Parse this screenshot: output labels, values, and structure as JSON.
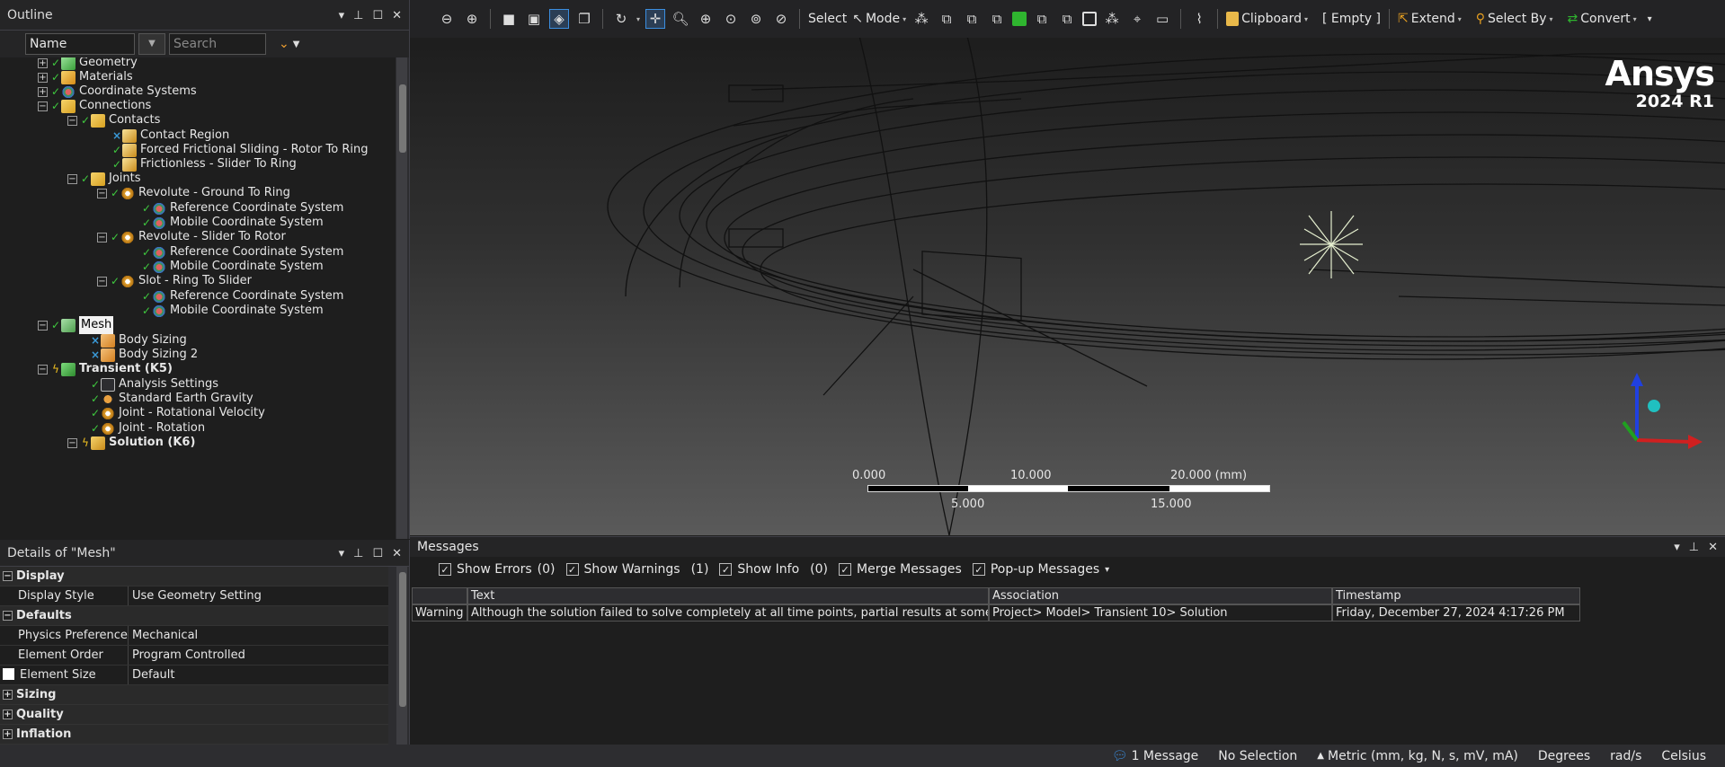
{
  "outline": {
    "title": "Outline",
    "filter_select": "Name",
    "search_placeholder": "Search Outline",
    "tree": [
      {
        "label": "Geometry"
      },
      {
        "label": "Materials"
      },
      {
        "label": "Coordinate Systems"
      },
      {
        "label": "Connections"
      },
      {
        "label": "Contacts"
      },
      {
        "label": "Contact Region"
      },
      {
        "label": "Forced Frictional Sliding - Rotor To Ring"
      },
      {
        "label": "Frictionless - Slider To Ring"
      },
      {
        "label": "Joints"
      },
      {
        "label": "Revolute - Ground To Ring"
      },
      {
        "label": "Reference Coordinate System"
      },
      {
        "label": "Mobile Coordinate System"
      },
      {
        "label": "Revolute - Slider To Rotor"
      },
      {
        "label": "Reference Coordinate System"
      },
      {
        "label": "Mobile Coordinate System"
      },
      {
        "label": "Slot - Ring To Slider"
      },
      {
        "label": "Reference Coordinate System"
      },
      {
        "label": "Mobile Coordinate System"
      },
      {
        "label": "Mesh"
      },
      {
        "label": "Body Sizing"
      },
      {
        "label": "Body Sizing 2"
      },
      {
        "label": "Transient (K5)"
      },
      {
        "label": "Analysis Settings"
      },
      {
        "label": "Standard Earth Gravity"
      },
      {
        "label": "Joint - Rotational Velocity"
      },
      {
        "label": "Joint - Rotation"
      },
      {
        "label": "Solution (K6)"
      }
    ]
  },
  "details": {
    "title": "Details of \"Mesh\"",
    "rows": [
      {
        "key": "Display"
      },
      {
        "key": "Display Style",
        "value": "Use Geometry Setting"
      },
      {
        "key": "Defaults"
      },
      {
        "key": "Physics Preference",
        "value": "Mechanical"
      },
      {
        "key": "Element Order",
        "value": "Program Controlled"
      },
      {
        "key": "Element Size",
        "value": "Default"
      },
      {
        "key": "Sizing"
      },
      {
        "key": "Quality"
      },
      {
        "key": "Inflation"
      }
    ]
  },
  "toolbar": {
    "select": "Select",
    "mode": "Mode",
    "clipboard": "Clipboard",
    "empty": "[ Empty ]",
    "extend": "Extend",
    "select_by": "Select By",
    "convert": "Convert"
  },
  "brand": {
    "name": "Ansys",
    "version": "2024 R1"
  },
  "scale": {
    "top": [
      "0.000",
      "10.000",
      "20.000 (mm)"
    ],
    "bottom": [
      "5.000",
      "15.000"
    ]
  },
  "messages": {
    "title": "Messages",
    "opts": [
      {
        "label": "Show Errors",
        "count": "(0)"
      },
      {
        "label": "Show Warnings",
        "count": "(1)"
      },
      {
        "label": "Show Info",
        "count": "(0)"
      },
      {
        "label": "Merge Messages",
        "count": ""
      },
      {
        "label": "Pop-up Messages",
        "count": ""
      }
    ],
    "headers": [
      "Text",
      "Association",
      "Timestamp"
    ],
    "row": {
      "type": "Warning",
      "text": "Although the solution failed to solve completely at all time points, partial results at some",
      "association": "Project> Model> Transient 10> Solution",
      "timestamp": "Friday, December 27, 2024 4:17:26 PM"
    }
  },
  "statusbar": {
    "messages": "1 Message",
    "selection": "No Selection",
    "units": "Metric (mm, kg, N, s, mV, mA)",
    "angle": "Degrees",
    "angular_velocity": "rad/s",
    "temperature": "Celsius"
  }
}
